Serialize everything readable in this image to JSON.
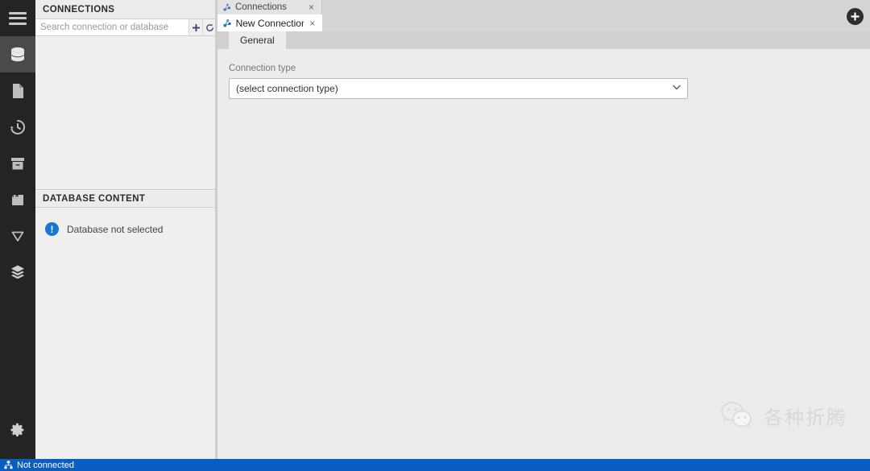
{
  "window": {
    "background_color": "#ececec",
    "accent_color": "#0a5ec2"
  },
  "rail": {
    "menu_label": "Menu",
    "items": [
      {
        "name": "database",
        "label": "Database Navigator",
        "icon": "database-icon",
        "active": true
      },
      {
        "name": "file",
        "label": "Projects",
        "icon": "file-icon",
        "active": false
      },
      {
        "name": "history",
        "label": "Query History",
        "icon": "history-icon",
        "active": false
      },
      {
        "name": "archive",
        "label": "Archive",
        "icon": "archive-icon",
        "active": false
      },
      {
        "name": "bookmarks",
        "label": "Bookmarks",
        "icon": "bookmark-icon",
        "active": false
      },
      {
        "name": "filter",
        "label": "Filters",
        "icon": "filter-icon",
        "active": false
      },
      {
        "name": "layers",
        "label": "Layers",
        "icon": "layers-icon",
        "active": false
      }
    ],
    "settings": {
      "label": "Settings",
      "icon": "gear-icon"
    }
  },
  "connections_panel": {
    "title": "CONNECTIONS",
    "search": {
      "placeholder": "Search connection or database",
      "value": "",
      "add_button": "+",
      "refresh_button": "↻"
    },
    "list_items": []
  },
  "database_content": {
    "title": "DATABASE CONTENT",
    "notice": {
      "icon": "info-icon",
      "badge": "!",
      "text": "Database not selected"
    }
  },
  "tabs": [
    {
      "label": "Connections",
      "icon": "connection-icon",
      "close": "×",
      "active": false
    },
    {
      "label": "New Connection",
      "icon": "connection-icon",
      "close": "×",
      "active": true
    }
  ],
  "subtabs": [
    {
      "label": "General",
      "active": true
    }
  ],
  "form": {
    "connection_type_label": "Connection type",
    "connection_type_value": "(select connection type)",
    "connection_type_options": [
      "(select connection type)"
    ],
    "chevron": "⌄"
  },
  "toolbar": {
    "add_label": "+"
  },
  "watermark": {
    "text": "各种折腾",
    "icon": "wechat-icon"
  },
  "statusbar": {
    "icon": "network-icon",
    "text": "Not connected"
  }
}
